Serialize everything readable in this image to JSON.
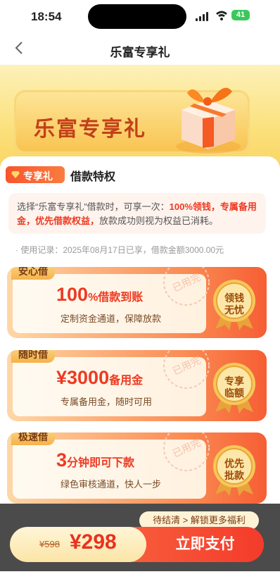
{
  "status_bar": {
    "time": "18:54",
    "battery": "41"
  },
  "nav": {
    "back_icon": "chevron-left-icon",
    "title": "乐富专享礼"
  },
  "hero": {
    "title": "乐富专享礼"
  },
  "section": {
    "tag_label": "专享礼",
    "title": "借款特权"
  },
  "info": {
    "prefix": "选择“乐富专享礼”借款时，可享一次：",
    "highlight": "100%领钱，专属备用金，优先借款权益，",
    "suffix": "放款成功则视为权益已消耗。"
  },
  "record": "· 使用记录：2025年08月17日已享，借款金额3000.00元",
  "cards": [
    {
      "label": "安心借",
      "big_num": "100",
      "big_unit": "%借款到账",
      "sub": "定制资金通道，保障放款",
      "medal": [
        "领钱",
        "无忧"
      ],
      "stamp": "已用完"
    },
    {
      "label": "随时借",
      "big_num": "¥3000",
      "big_unit": "备用金",
      "sub": "专属备用金，随时可用",
      "medal": [
        "专享",
        "临额"
      ],
      "stamp": "已用完"
    },
    {
      "label": "极速借",
      "big_num": "3",
      "big_unit": "分钟即可下款",
      "sub": "绿色审核通道，快人一步",
      "medal": [
        "优先",
        "批款"
      ],
      "stamp": "已用完"
    }
  ],
  "bottom": {
    "hint": "待结清 > 解锁更多福利",
    "old_price": "¥598",
    "price": "¥298",
    "pay_label": "立即支付"
  },
  "colors": {
    "accent": "#ee3a22",
    "orange": "#f65e34",
    "gold": "#f5b24a"
  }
}
